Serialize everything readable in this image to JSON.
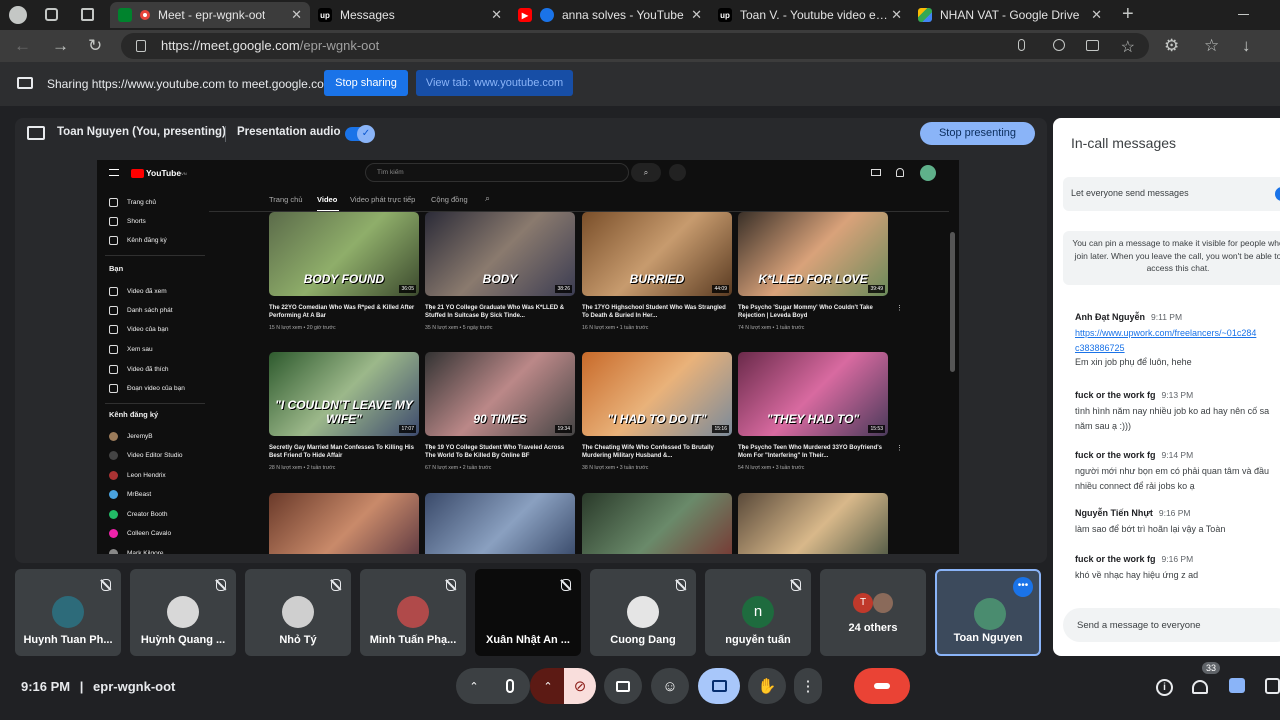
{
  "browser": {
    "tabs": [
      {
        "label": "Meet - epr-wgnk-oot",
        "active": true
      },
      {
        "label": "Messages"
      },
      {
        "label": "anna solves - YouTube"
      },
      {
        "label": "Toan V. - Youtube video editor wi"
      },
      {
        "label": "NHAN VAT - Google Drive"
      }
    ],
    "new_tab": "+",
    "url_host": "https://meet.google.com",
    "url_path": "/epr-wgnk-oot"
  },
  "sharing_bar": {
    "text": "Sharing https://www.youtube.com to meet.google.com",
    "stop_sharing": "Stop sharing",
    "view_tab": "View tab: www.youtube.com"
  },
  "presenting_bar": {
    "title": "Toan Nguyen (You, presenting)",
    "audio_label": "Presentation audio",
    "stop_presenting": "Stop presenting"
  },
  "youtube": {
    "logo": "YouTube",
    "logo_sup": "VN",
    "search_placeholder": "Tìm kiếm",
    "sidebar": [
      "Trang chủ",
      "Shorts",
      "Kênh đăng ký",
      "Bạn",
      "Video đã xem",
      "Danh sách phát",
      "Video của bạn",
      "Xem sau",
      "Video đã thích",
      "Đoạn video của bạn",
      "Kênh đăng ký",
      "JeremyB",
      "Video Editor Studio",
      "Leon Hendrix",
      "MrBeast",
      "Creator Booth",
      "Colleen Cavalo",
      "Mark Kilgore"
    ],
    "chips": [
      "Trang chủ",
      "Video",
      "Video phát trực tiếp",
      "Cộng đồng"
    ],
    "videos": [
      {
        "overlay": "BODY FOUND",
        "dur": "36:05",
        "title": "The 22YO Comedian Who Was R*ped & Killed After Performing At A Bar",
        "meta": "15 N lượt xem • 20 giờ trước"
      },
      {
        "overlay": "BODY",
        "dur": "38:26",
        "title": "The 21 YO College Graduate Who Was K*LLED & Stuffed In Suitcase By Sick Tinde...",
        "meta": "35 N lượt xem • 5 ngày trước"
      },
      {
        "overlay": "BURRIED",
        "dur": "44:09",
        "title": "The 17YO Highschool Student Who Was Strangled To Death & Buried In Her...",
        "meta": "16 N lượt xem • 1 tuần trước"
      },
      {
        "overlay": "K*LLED FOR LOVE",
        "dur": "39:49",
        "title": "The Psycho 'Sugar Mommy' Who Couldn't Take Rejection | Leveda Boyd",
        "meta": "74 N lượt xem • 1 tuần trước"
      },
      {
        "overlay": "\"I COULDN'T LEAVE MY WIFE\"",
        "dur": "17:07",
        "title": "Secretly Gay Married Man Confesses To Killing His Best Friend To Hide Affair",
        "meta": "28 N lượt xem • 2 tuần trước"
      },
      {
        "overlay": "90 TIMES",
        "dur": "19:34",
        "title": "The 19 YO College Student Who Traveled Across The World To Be Killed By Online BF",
        "meta": "67 N lượt xem • 2 tuần trước"
      },
      {
        "overlay": "\"I HAD TO DO IT\"",
        "dur": "15:16",
        "title": "The Cheating Wife Who Confessed To Brutally Murdering Military Husband &...",
        "meta": "38 N lượt xem • 3 tuần trước"
      },
      {
        "overlay": "\"THEY HAD TO\"",
        "dur": "15:53",
        "title": "The Psycho Teen Who Murdered 33YO Boyfriend's Mom For \"Interfering\" In Their...",
        "meta": "54 N lượt xem • 3 tuần trước"
      }
    ]
  },
  "participants": [
    {
      "name": "Huynh Tuan Ph...",
      "color": "#2d6b7a"
    },
    {
      "name": "Huỳnh Quang ...",
      "color": "#d8d8d8"
    },
    {
      "name": "Nhỏ Tý",
      "color": "#cfcfcf"
    },
    {
      "name": "Minh Tuấn Phạ...",
      "color": "#b04a4a"
    },
    {
      "name": "Xuân Nhật An ...",
      "color": "#000000"
    },
    {
      "name": "Cuong Dang",
      "color": "#e5e5e5"
    },
    {
      "name": "nguyễn tuấn",
      "color": "#1e6b3e",
      "letter": "n"
    },
    {
      "name": "24 others",
      "color": "#c0392b",
      "letter": "T"
    },
    {
      "name": "Toan Nguyen",
      "color": "#4a8c6f"
    }
  ],
  "chat": {
    "title": "In-call messages",
    "toggle_label": "Let everyone send messages",
    "pin_info": "You can pin a message to make it visible for people who join later. When you leave the call, you won't be able to access this chat.",
    "messages": [
      {
        "name": "Anh Đạt Nguyễn",
        "time": "9:11 PM",
        "lines": [
          "https://www.upwork.com/freelancers/~01c284",
          "c383886725",
          "Em xin job phụ để luôn, hehe"
        ]
      },
      {
        "name": "fuck or the work fg",
        "time": "9:13 PM",
        "lines": [
          "tình hình năm nay nhiều job ko ad hay nên cố sa",
          "năm sau ạ :)))"
        ]
      },
      {
        "name": "fuck or the work fg",
        "time": "9:14 PM",
        "lines": [
          "người mới như bọn em có phải quan tâm và đầu",
          "nhiều connect để rải jobs ko ạ"
        ]
      },
      {
        "name": "Nguyễn Tiến Nhựt",
        "time": "9:16 PM",
        "lines": [
          "làm sao để bớt trì hoãn lại vậy a Toàn"
        ]
      },
      {
        "name": "fuck or the work fg",
        "time": "9:16 PM",
        "lines": [
          "khó về nhạc hay hiệu ứng z ad"
        ]
      }
    ],
    "input_placeholder": "Send a message to everyone"
  },
  "bottom": {
    "time": "9:16 PM",
    "separator": "|",
    "meeting_code": "epr-wgnk-oot",
    "people_count": "33"
  },
  "colors": {
    "accent": "#1a73e8",
    "hangup": "#ea4335",
    "present_active": "#a8c7fa"
  }
}
